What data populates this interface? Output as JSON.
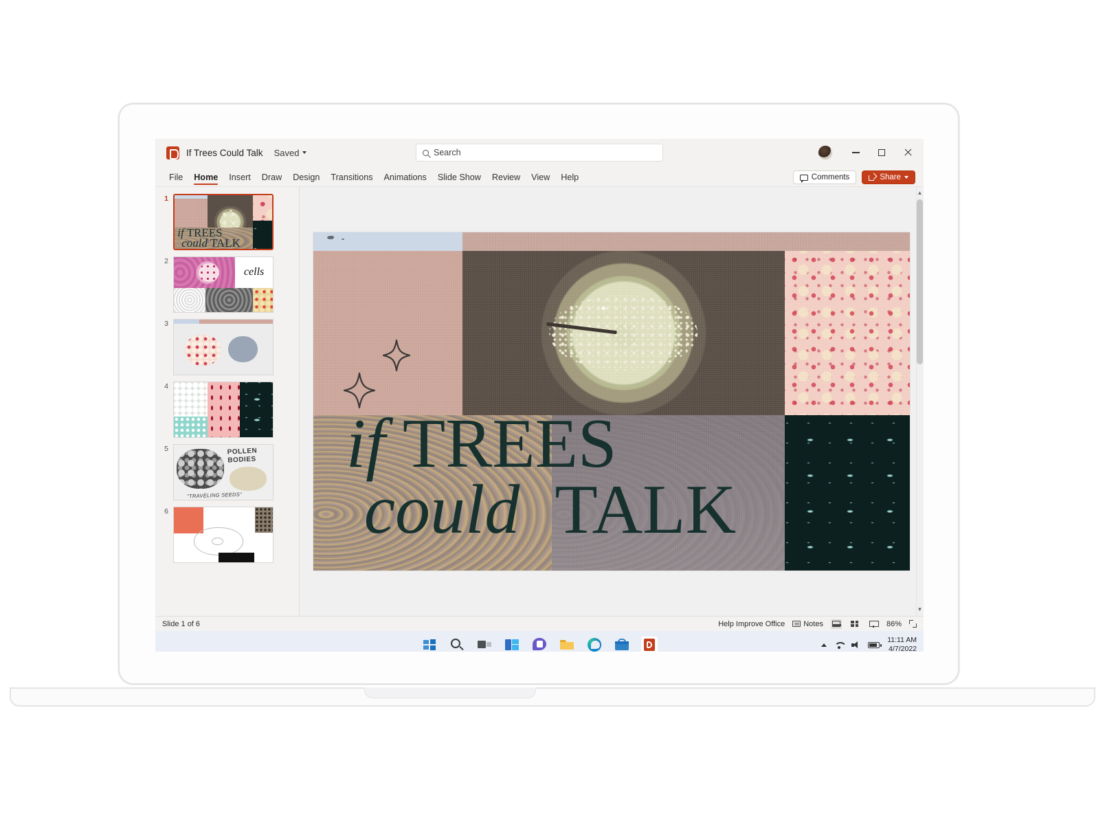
{
  "app": {
    "logo_icon": "powerpoint-icon",
    "doc_title": "If Trees Could Talk",
    "save_state": "Saved",
    "save_state_chevron_icon": "chevron-down-icon"
  },
  "search": {
    "icon": "search-icon",
    "placeholder": "Search",
    "value": "Search"
  },
  "window_controls": {
    "avatar_icon": "user-avatar",
    "minimize_icon": "minimize-icon",
    "maximize_icon": "maximize-icon",
    "close_icon": "close-icon"
  },
  "ribbon": {
    "tabs": [
      {
        "label": "File",
        "active": false
      },
      {
        "label": "Home",
        "active": true
      },
      {
        "label": "Insert",
        "active": false
      },
      {
        "label": "Draw",
        "active": false
      },
      {
        "label": "Design",
        "active": false
      },
      {
        "label": "Transitions",
        "active": false
      },
      {
        "label": "Animations",
        "active": false
      },
      {
        "label": "Slide Show",
        "active": false
      },
      {
        "label": "Review",
        "active": false
      },
      {
        "label": "View",
        "active": false
      },
      {
        "label": "Help",
        "active": false
      }
    ],
    "comments_label": "Comments",
    "comments_icon": "comment-icon",
    "share_label": "Share",
    "share_icon": "share-icon",
    "share_chevron_icon": "chevron-down-icon",
    "accent_color": "#c43e1c"
  },
  "thumbnails": {
    "selected_index": 1,
    "slides": [
      {
        "number": "1",
        "title": "if TREES could TALK",
        "selected": true
      },
      {
        "number": "2",
        "title": "cells",
        "selected": false
      },
      {
        "number": "3",
        "title": "",
        "selected": false
      },
      {
        "number": "4",
        "title": "",
        "selected": false
      },
      {
        "number": "5",
        "title": "POLLEN BODIES \"TRAVELING SEEDS\"",
        "selected": false
      },
      {
        "number": "6",
        "title": "",
        "selected": false
      }
    ]
  },
  "slide": {
    "title_line1_italic": "if",
    "title_line1_roman": "TREES",
    "title_line2_italic": "could",
    "title_line2_roman": "TALK",
    "title_color": "#17312f",
    "panels": [
      {
        "name": "pale-blue-sky-strip",
        "color": "#ccd8e6"
      },
      {
        "name": "dusty-rose-panel",
        "color": "#cda79c"
      },
      {
        "name": "mauve-top-strip",
        "color": "#c8a79d"
      },
      {
        "name": "dark-stem-cross-section",
        "color": "#5b5048"
      },
      {
        "name": "pink-cell-tissue",
        "color": "#f0c4b8"
      },
      {
        "name": "wood-grain-rings",
        "color": "#a18d7e"
      },
      {
        "name": "grey-slate-panel",
        "color": "#8b8189"
      },
      {
        "name": "dark-teal-pollen-tubes",
        "color": "#0c211f"
      }
    ],
    "sparkles_icon": "four-point-star-icon"
  },
  "scrollbar": {
    "up_arrow_icon": "chevron-up-icon",
    "down_arrow_icon": "chevron-down-icon"
  },
  "status_bar": {
    "slide_counter": "Slide 1 of 6",
    "help_improve": "Help Improve Office",
    "notes_label": "Notes",
    "notes_icon": "notes-icon",
    "view_normal_icon": "normal-view-icon",
    "view_sorter_icon": "slide-sorter-icon",
    "view_reading_icon": "reading-view-icon",
    "zoom_level": "86%",
    "fit_slide_icon": "fit-to-window-icon"
  },
  "taskbar": {
    "icons": [
      {
        "name": "start-icon",
        "color": "#2f7dd1"
      },
      {
        "name": "search-icon",
        "color": "#3a3a3a"
      },
      {
        "name": "task-view-icon",
        "color": "#44474b"
      },
      {
        "name": "widgets-icon",
        "color": "#1e9ae0"
      },
      {
        "name": "chat-teams-icon",
        "color": "#6a57c7"
      },
      {
        "name": "file-explorer-icon",
        "color": "#f5b731"
      },
      {
        "name": "edge-icon",
        "color": "#1d9ad6"
      },
      {
        "name": "store-icon",
        "color": "#2f82c4"
      },
      {
        "name": "powerpoint-icon",
        "color": "#c43e1c"
      }
    ],
    "tray": {
      "show_hidden_icon": "chevron-up-icon",
      "wifi_icon": "wifi-icon",
      "volume_icon": "volume-icon",
      "battery_icon": "battery-icon",
      "time": "11:11 AM",
      "date": "4/7/2022"
    }
  }
}
